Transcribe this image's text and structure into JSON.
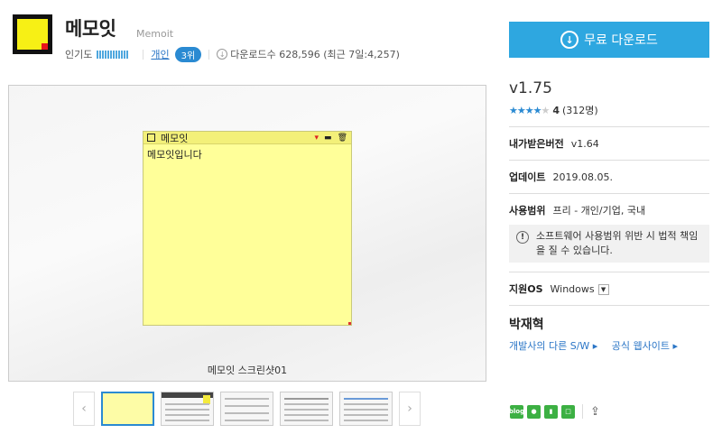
{
  "app": {
    "name": "메모잇",
    "name_en": "Memoit",
    "popularity_label": "인기도",
    "category": "개인",
    "rank": "3위",
    "downloads": "다운로드수 628,596 (최근 7일:4,257)"
  },
  "download_button": {
    "label": "무료 다운로드",
    "icon": "download-circle-icon"
  },
  "screenshot": {
    "window_title": "메모잇",
    "content": "메모잇입니다",
    "caption": "메모잇 스크린샷01"
  },
  "thumbnails": {
    "count": 5,
    "active_index": 0
  },
  "details": {
    "version": "v1.75",
    "rating_value": 4,
    "rating_count": "(312명)",
    "downloaded_label": "내가받은버전",
    "downloaded_version": "v1.64",
    "update_label": "업데이트",
    "update_date": "2019.08.05.",
    "usage_label": "사용범위",
    "usage_value": "프리 - 개인/기업, 국내",
    "notice": "소프트웨어 사용범위 위반 시 법적 책임을 질 수 있습니다.",
    "os_label": "지원OS",
    "os_value": "Windows",
    "developer": "박재혁",
    "dev_link_other": "개발사의 다른 S/W ▸",
    "dev_link_site": "공식 웹사이트 ▸"
  },
  "share": {
    "icons": [
      "blog-icon",
      "talk-icon",
      "bookmark-icon",
      "note-icon",
      "share-out-icon"
    ],
    "colors": [
      "#3cb043",
      "#3cb043",
      "#3cb043",
      "#3cb043"
    ]
  },
  "colors": {
    "accent": "#2ea7e0",
    "link": "#2a75c6",
    "memo_bg": "#ffff99"
  }
}
